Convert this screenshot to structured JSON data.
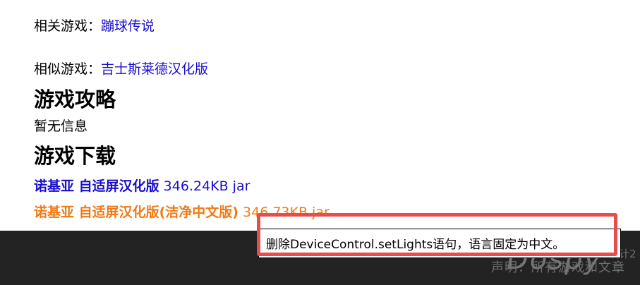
{
  "related": {
    "label": "相关游戏：",
    "link": "蹦球传说"
  },
  "similar": {
    "label": "相似游戏：",
    "link": "吉士斯莱德汉化版"
  },
  "guide": {
    "title": "游戏攻略",
    "text": "暂无信息"
  },
  "download": {
    "title": "游戏下载",
    "items": [
      {
        "name": "诺基亚 自适屏汉化版",
        "size": "346.24KB jar"
      },
      {
        "name": "诺基亚 自适屏汉化版(洁净中文版)",
        "size": "346.73KB jar"
      }
    ]
  },
  "tooltip": {
    "text": "删除DeviceControl.setLights语句，语言固定为中文。"
  },
  "footer": {
    "text": "声明：所有游戏和文章",
    "text_right": "设计2"
  },
  "watermark": {
    "text": "Dospy"
  },
  "colors": {
    "link_blue": "#1a0dcc",
    "orange": "#f07a14",
    "footer_bg": "#232323",
    "highlight_red": "#e84d4d"
  }
}
